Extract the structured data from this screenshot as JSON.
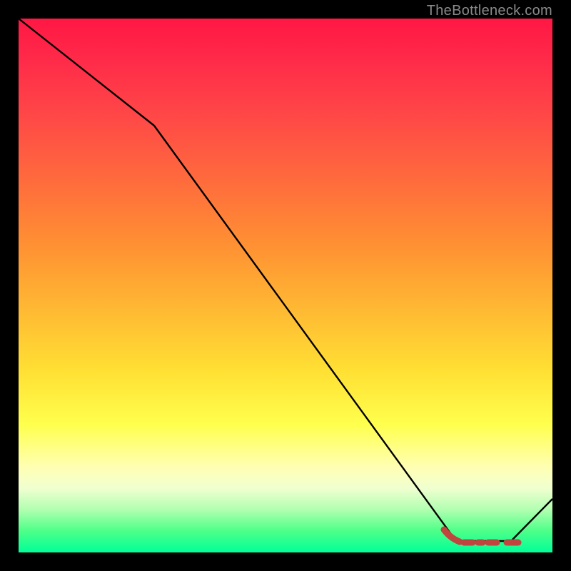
{
  "attribution": "TheBottleneck.com",
  "chart_data": {
    "type": "line",
    "title": "",
    "xlabel": "",
    "ylabel": "",
    "xlim": [
      0,
      100
    ],
    "ylim": [
      0,
      100
    ],
    "series": [
      {
        "name": "main-curve",
        "color": "#000000",
        "x": [
          0,
          25,
          82,
          92,
          100
        ],
        "y": [
          100,
          80,
          2,
          2,
          10
        ]
      },
      {
        "name": "optimal-zone",
        "color": "#c1453f",
        "style": "dashed-thick",
        "x": [
          80,
          82,
          84,
          92,
          94
        ],
        "y": [
          4,
          2.6,
          2,
          2,
          2
        ]
      }
    ]
  }
}
